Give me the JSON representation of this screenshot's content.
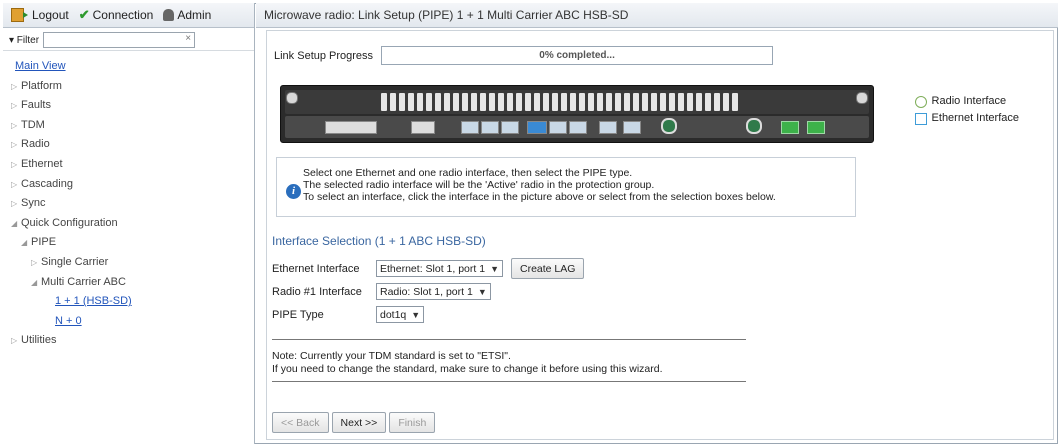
{
  "topbar": {
    "logout": "Logout",
    "connection": "Connection",
    "admin": "Admin"
  },
  "filter": {
    "label": "▾ Filter",
    "value": "",
    "clear": "×"
  },
  "tree": [
    {
      "label": "Main View",
      "kind": "link",
      "indent": 0
    },
    {
      "label": "Platform",
      "kind": "collapsed",
      "indent": 0
    },
    {
      "label": "Faults",
      "kind": "collapsed",
      "indent": 0
    },
    {
      "label": "TDM",
      "kind": "collapsed",
      "indent": 0
    },
    {
      "label": "Radio",
      "kind": "collapsed",
      "indent": 0
    },
    {
      "label": "Ethernet",
      "kind": "collapsed",
      "indent": 0
    },
    {
      "label": "Cascading",
      "kind": "collapsed",
      "indent": 0
    },
    {
      "label": "Sync",
      "kind": "collapsed",
      "indent": 0
    },
    {
      "label": "Quick Configuration",
      "kind": "expanded",
      "indent": 0
    },
    {
      "label": "PIPE",
      "kind": "expanded",
      "indent": 1
    },
    {
      "label": "Single Carrier",
      "kind": "collapsed",
      "indent": 2
    },
    {
      "label": "Multi Carrier ABC",
      "kind": "expanded",
      "indent": 2
    },
    {
      "label": "1 + 1 (HSB-SD)",
      "kind": "link",
      "indent": 4
    },
    {
      "label": "N + 0",
      "kind": "link",
      "indent": 4
    },
    {
      "label": "Utilities",
      "kind": "collapsed",
      "indent": 0
    }
  ],
  "header": {
    "title": "Microwave radio: Link Setup (PIPE) 1 + 1 Multi Carrier ABC HSB-SD"
  },
  "progress": {
    "label": "Link Setup Progress",
    "percent": 0,
    "text": "0% completed..."
  },
  "legend": {
    "radio": "Radio Interface",
    "ethernet": "Ethernet Interface"
  },
  "info": {
    "line1": "Select one Ethernet and one radio interface, then select the PIPE type.",
    "line2": "The selected radio interface will be the 'Active' radio in the protection group.",
    "line3": "To select an interface, click the interface in the picture above or select from the selection boxes below."
  },
  "form": {
    "section_title": "Interface Selection (1 + 1 ABC HSB-SD)",
    "ethernet_label": "Ethernet Interface",
    "ethernet_value": "Ethernet: Slot 1, port 1",
    "create_lag": "Create LAG",
    "radio_label": "Radio #1 Interface",
    "radio_value": "Radio: Slot 1, port 1",
    "pipe_label": "PIPE Type",
    "pipe_value": "dot1q"
  },
  "note": {
    "line1": "Note: Currently your TDM standard is set to \"ETSI\".",
    "line2": "If you need to change the standard, make sure to change it before using this wizard."
  },
  "nav": {
    "back": "<< Back",
    "next": "Next >>",
    "finish": "Finish"
  },
  "colors": {
    "link": "#2255bb",
    "section_title": "#3a66a0",
    "radio_legend": "#7fae5a",
    "ethernet_legend": "#3e9cd8",
    "info_icon": "#2a6ebd"
  }
}
